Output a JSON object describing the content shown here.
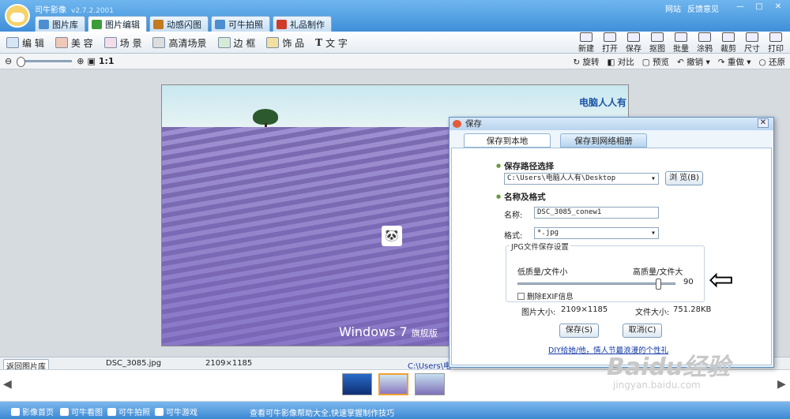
{
  "app": {
    "name": "司牛影像",
    "version": "v2.7.2.2001",
    "toplinks": [
      "网站",
      "反馈意见"
    ]
  },
  "main_tabs": [
    {
      "label": "图片库",
      "color": "#4c8fd0"
    },
    {
      "label": "图片编辑",
      "color": "#3b9c3a"
    },
    {
      "label": "动感闪图",
      "color": "#c47a1f"
    },
    {
      "label": "可牛拍照",
      "color": "#4c8fd0"
    },
    {
      "label": "礼品制作",
      "color": "#d03a2a"
    }
  ],
  "tools": [
    "编 辑",
    "美 容",
    "场 景",
    "高清场景",
    "边 框",
    "饰 品",
    "文 字"
  ],
  "right_tools": [
    "新建",
    "打开",
    "保存",
    "抠图",
    "批量",
    "涂鸦",
    "裁剪",
    "尺寸",
    "打印"
  ],
  "zoom": {
    "ratio": "1:1"
  },
  "sub_tools": [
    "旋转",
    "对比",
    "预览",
    "撤销",
    "重做",
    "还原"
  ],
  "photo": {
    "watermark": "电脑人人有",
    "os_brand": "Windows 7",
    "os_edition": "旗舰版"
  },
  "status": {
    "back": "返回图片库",
    "filename": "DSC_3085.jpg",
    "dims": "2109×1185",
    "path": "C:\\Users\\电"
  },
  "dialog": {
    "title": "保存",
    "tabs": [
      "保存到本地",
      "保存到网络相册"
    ],
    "path_section": "保存路径选择",
    "path_value": "C:\\Users\\电脑人人有\\Desktop",
    "browse": "浏 览(B)",
    "format_section": "名称及格式",
    "name_label": "名称:",
    "name_value": "DSC_3085_conew1",
    "format_label": "格式:",
    "format_value": "*.jpg",
    "group_title": "JPG文件保存设置",
    "low_label": "低质量/文件小",
    "high_label": "高质量/文件大",
    "quality": "90",
    "exif_label": "删除EXIF信息",
    "size_label": "图片大小:",
    "size_value": "2109×1185",
    "filesize_label": "文件大小:",
    "filesize_value": "751.28KB",
    "save": "保存(S)",
    "cancel": "取消(C)",
    "link": "DIY给她/他，情人节最浪漫的个性礼"
  },
  "bottom": {
    "items": [
      "影像首页",
      "可牛看图",
      "可牛拍照",
      "可牛游戏"
    ],
    "tip": "查看可牛影像帮助大全,快速掌握制作技巧"
  },
  "overlay": {
    "brand": "Baidu经验",
    "url": "jingyan.baidu.com"
  }
}
